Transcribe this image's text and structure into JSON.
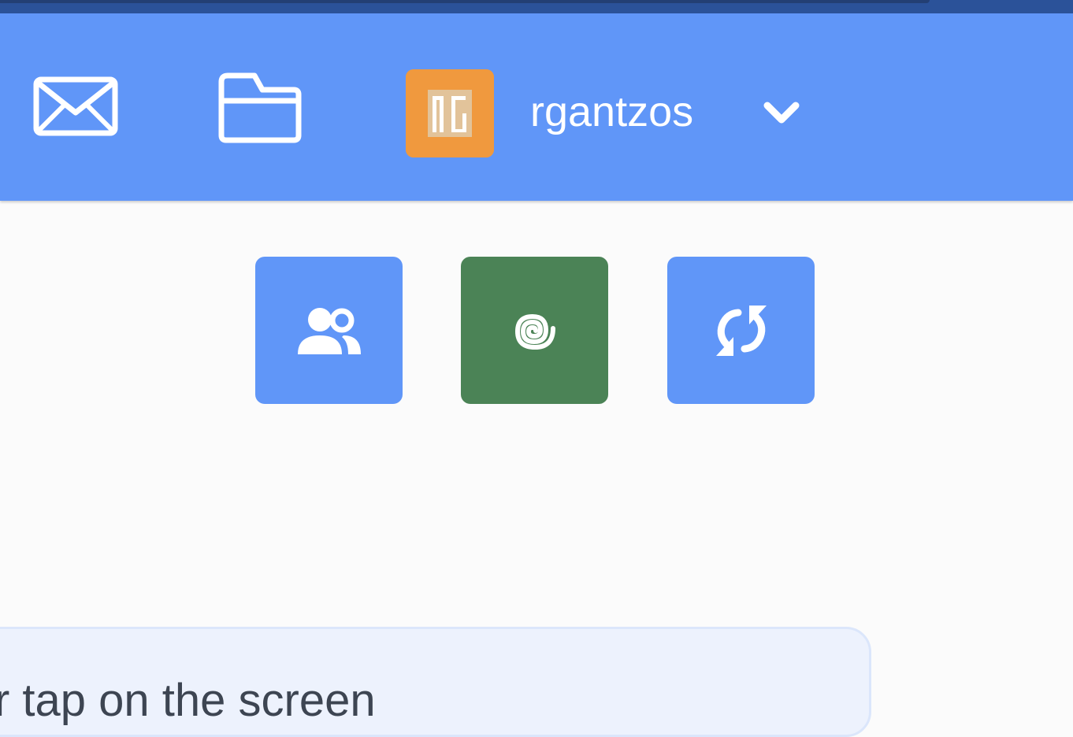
{
  "header": {
    "user": {
      "avatar_initials": "RG",
      "username": "rgantzos"
    },
    "icons": {
      "messages": "mail-icon",
      "projects": "folder-icon",
      "menu": "chevron-down-icon"
    }
  },
  "actions": [
    {
      "icon": "users-icon",
      "color": "#6096f8"
    },
    {
      "icon": "spiral-icon",
      "color": "#4b8356"
    },
    {
      "icon": "sync-icon",
      "color": "#6096f8"
    }
  ],
  "message": {
    "text": "r tap on the screen"
  },
  "colors": {
    "header": "#6096f8",
    "top_strip": "#2b5299",
    "avatar_bg": "#f0993e",
    "active_button": "#4b8356",
    "panel_bg": "#edf2fd"
  }
}
